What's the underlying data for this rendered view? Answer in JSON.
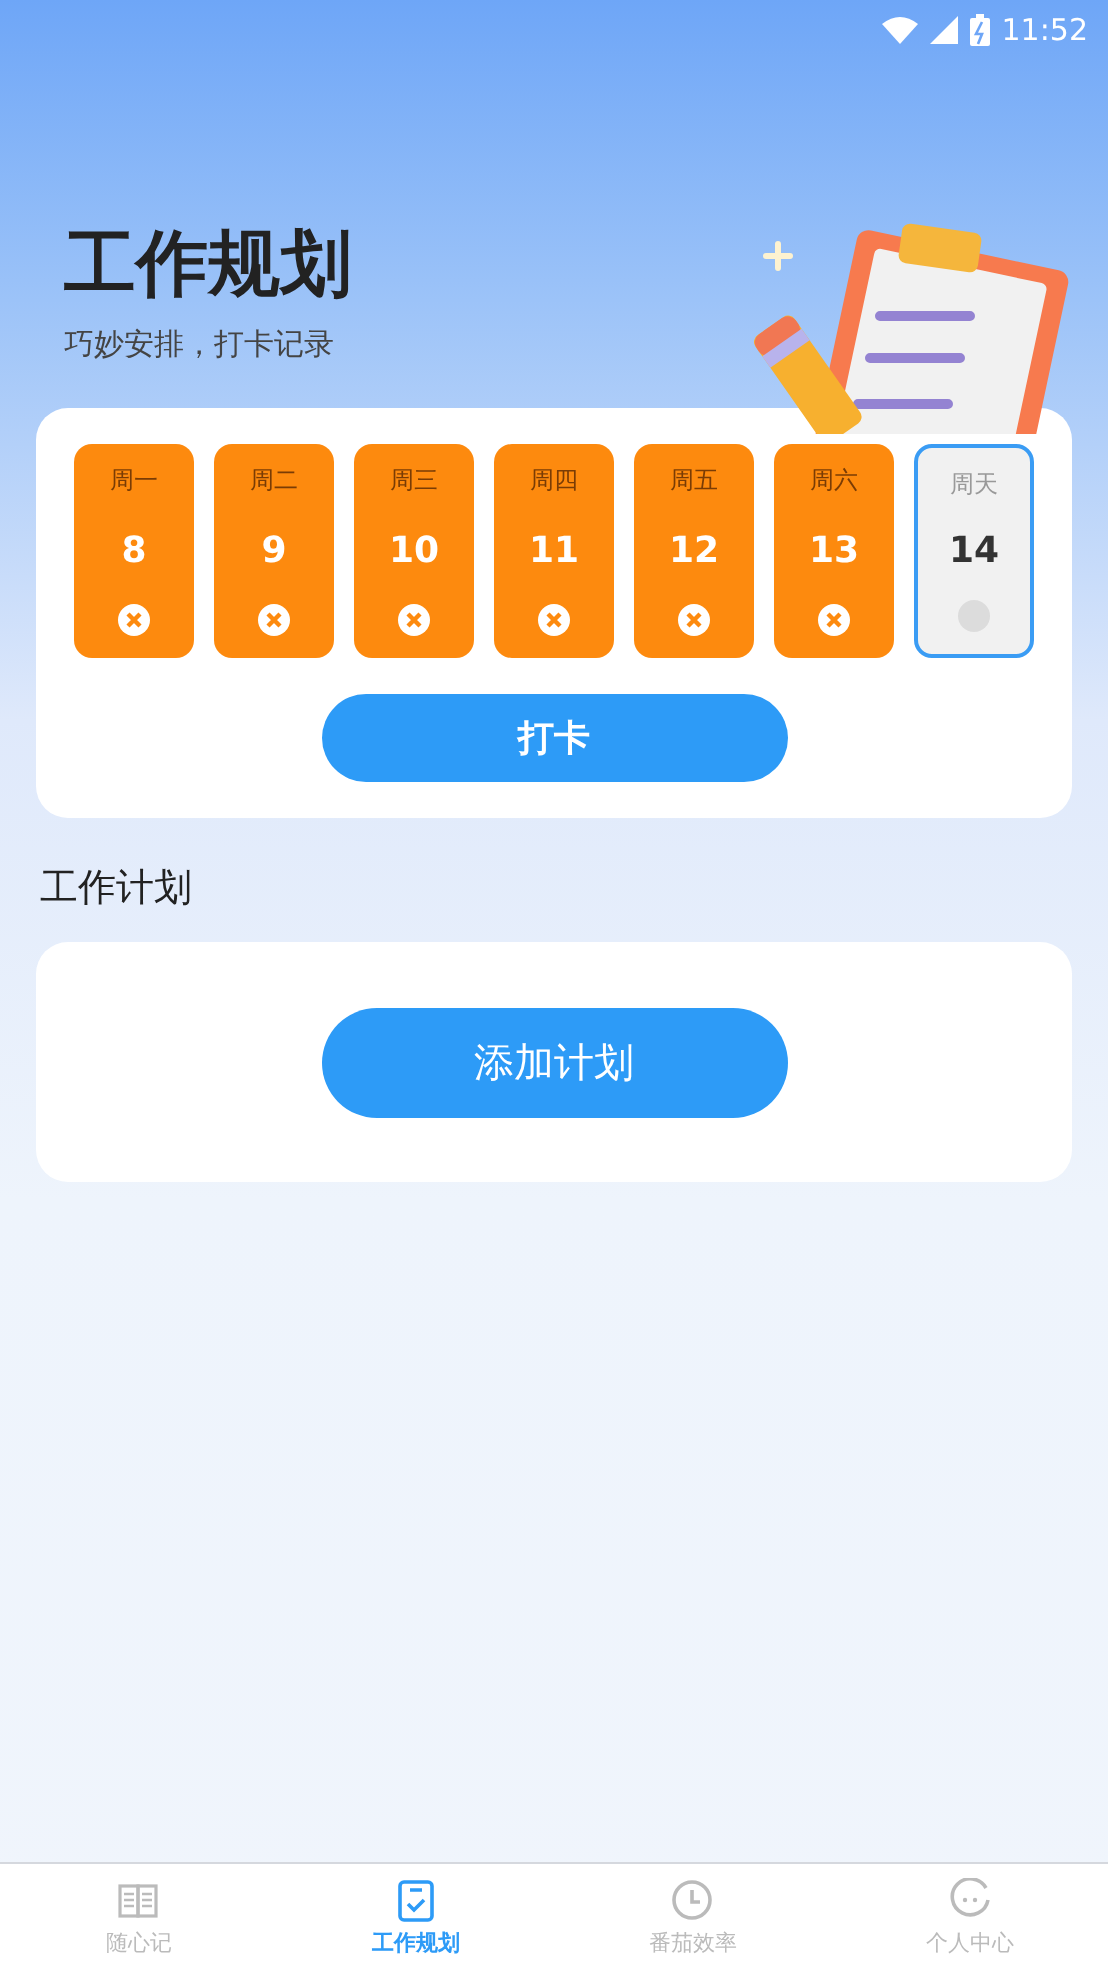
{
  "status_bar": {
    "time": "11:52"
  },
  "header": {
    "title": "工作规划",
    "subtitle": "巧妙安排，打卡记录"
  },
  "days": [
    {
      "weekday": "周一",
      "date": "8",
      "kind": "missed",
      "selected": false
    },
    {
      "weekday": "周二",
      "date": "9",
      "kind": "missed",
      "selected": false
    },
    {
      "weekday": "周三",
      "date": "10",
      "kind": "missed",
      "selected": false
    },
    {
      "weekday": "周四",
      "date": "11",
      "kind": "missed",
      "selected": false
    },
    {
      "weekday": "周五",
      "date": "12",
      "kind": "missed",
      "selected": false
    },
    {
      "weekday": "周六",
      "date": "13",
      "kind": "missed",
      "selected": false
    },
    {
      "weekday": "周天",
      "date": "14",
      "kind": "pending",
      "selected": true
    }
  ],
  "checkin_button": "打卡",
  "plan_section": {
    "title": "工作计划",
    "add_button": "添加计划"
  },
  "tabs": [
    {
      "label": "随心记",
      "kind": "book",
      "selected": false
    },
    {
      "label": "工作规划",
      "kind": "checklist",
      "selected": true
    },
    {
      "label": "番茄效率",
      "kind": "clock",
      "selected": false
    },
    {
      "label": "个人中心",
      "kind": "face",
      "selected": false
    }
  ]
}
